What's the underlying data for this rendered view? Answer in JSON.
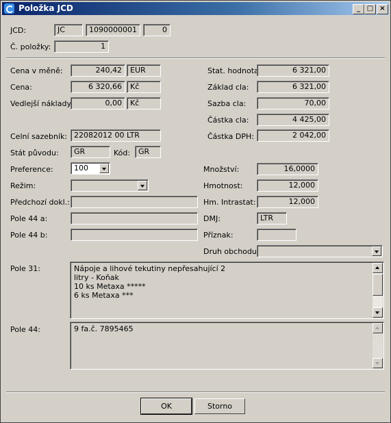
{
  "window": {
    "title": "Položka JCD"
  },
  "jcd": {
    "label": "JCD:",
    "type": "JC",
    "number": "1090000001",
    "index": "0"
  },
  "item_no": {
    "label": "Č. položky:",
    "value": "1"
  },
  "left": {
    "cena_mena": {
      "label": "Cena v měně:",
      "value": "240,42",
      "currency": "EUR"
    },
    "cena": {
      "label": "Cena:",
      "value": "6 320,66",
      "currency": "Kč"
    },
    "vedlejsi": {
      "label": "Vedlejší náklady:",
      "value": "0,00",
      "currency": "Kč"
    },
    "sazebnik": {
      "label": "Celní sazebník:",
      "value": "22082012 00  LTR"
    },
    "stat": {
      "label": "Stát původu:",
      "value": "GR",
      "kod_label": "Kód:",
      "kod": "GR"
    },
    "preference": {
      "label": "Preference:",
      "value": "100"
    },
    "rezim": {
      "label": "Režim:",
      "value": ""
    },
    "predchozi": {
      "label": "Předchozí dokl.:",
      "value": ""
    },
    "pole44a": {
      "label": "Pole 44 a:",
      "value": ""
    },
    "pole44b": {
      "label": "Pole 44 b:",
      "value": ""
    }
  },
  "right": {
    "stat_hodnota": {
      "label": "Stat. hodnota:",
      "value": "6 321,00"
    },
    "zaklad_cla": {
      "label": "Základ cla:",
      "value": "6 321,00"
    },
    "sazba_cla": {
      "label": "Sazba cla:",
      "value": "70,00"
    },
    "castka_cla": {
      "label": "Částka cla:",
      "value": "4 425,00"
    },
    "castka_dph": {
      "label": "Částka DPH:",
      "value": "2 042,00"
    },
    "mnozstvi": {
      "label": "Množství:",
      "value": "16,0000"
    },
    "hmotnost": {
      "label": "Hmotnost:",
      "value": "12,000"
    },
    "hm_intrastat": {
      "label": "Hm. Intrastat:",
      "value": "12,000"
    },
    "dmj": {
      "label": "DMJ:",
      "value": "LTR"
    },
    "priznak": {
      "label": "Příznak:",
      "value": ""
    },
    "druh_obchodu": {
      "label": "Druh obchodu:",
      "value": ""
    }
  },
  "pole31": {
    "label": "Pole 31:",
    "lines": [
      "Nápoje a lihové tekutiny nepřesahující 2",
      "litry - Koňak",
      "10 ks Metaxa *****",
      "6 ks Metaxa ***"
    ]
  },
  "pole44": {
    "label": "Pole 44:",
    "lines": [
      "9  fa.č. 7895465"
    ]
  },
  "buttons": {
    "ok": "OK",
    "cancel": "Storno"
  }
}
